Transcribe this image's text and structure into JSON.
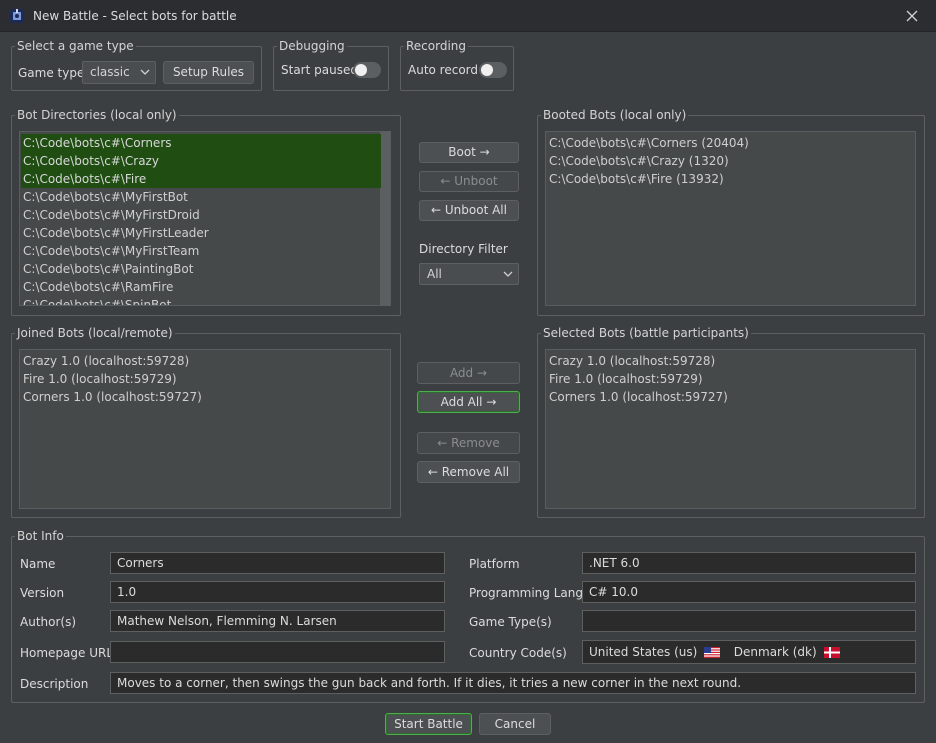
{
  "window": {
    "title": "New Battle - Select bots for battle",
    "app_icon": "robot-tank-icon",
    "close_icon": "close-icon"
  },
  "game_type": {
    "legend": "Select a game type",
    "label": "Game type",
    "selected": "classic",
    "setup_rules_label": "Setup Rules"
  },
  "debugging": {
    "legend": "Debugging",
    "start_paused_label": "Start paused",
    "start_paused_on": false
  },
  "recording": {
    "legend": "Recording",
    "auto_record_label": "Auto record",
    "auto_record_on": false
  },
  "bot_directories": {
    "legend": "Bot Directories (local only)",
    "items": [
      {
        "label": "C:\\Code\\bots\\c#\\Corners",
        "selected": true
      },
      {
        "label": "C:\\Code\\bots\\c#\\Crazy",
        "selected": true
      },
      {
        "label": "C:\\Code\\bots\\c#\\Fire",
        "selected": true
      },
      {
        "label": "C:\\Code\\bots\\c#\\MyFirstBot",
        "selected": false
      },
      {
        "label": "C:\\Code\\bots\\c#\\MyFirstDroid",
        "selected": false
      },
      {
        "label": "C:\\Code\\bots\\c#\\MyFirstLeader",
        "selected": false
      },
      {
        "label": "C:\\Code\\bots\\c#\\MyFirstTeam",
        "selected": false
      },
      {
        "label": "C:\\Code\\bots\\c#\\PaintingBot",
        "selected": false
      },
      {
        "label": "C:\\Code\\bots\\c#\\RamFire",
        "selected": false
      },
      {
        "label": "C:\\Code\\bots\\c#\\SpinBot",
        "selected": false
      }
    ]
  },
  "boot_controls": {
    "boot_label": "Boot →",
    "unboot_label": "← Unboot",
    "unboot_all_label": "← Unboot All",
    "filter_label": "Directory Filter",
    "filter_selected": "All"
  },
  "booted_bots": {
    "legend": "Booted Bots (local only)",
    "items": [
      "C:\\Code\\bots\\c#\\Corners (20404)",
      "C:\\Code\\bots\\c#\\Crazy (1320)",
      "C:\\Code\\bots\\c#\\Fire (13932)"
    ]
  },
  "joined_bots": {
    "legend": "Joined Bots (local/remote)",
    "items": [
      "Crazy 1.0 (localhost:59728)",
      "Fire 1.0 (localhost:59729)",
      "Corners 1.0 (localhost:59727)"
    ]
  },
  "add_controls": {
    "add_label": "Add →",
    "add_all_label": "Add All →",
    "remove_label": "← Remove",
    "remove_all_label": "← Remove All"
  },
  "selected_bots": {
    "legend": "Selected Bots (battle participants)",
    "items": [
      "Crazy 1.0 (localhost:59728)",
      "Fire 1.0 (localhost:59729)",
      "Corners 1.0 (localhost:59727)"
    ]
  },
  "bot_info": {
    "legend": "Bot Info",
    "name_label": "Name",
    "name": "Corners",
    "version_label": "Version",
    "version": "1.0",
    "authors_label": "Author(s)",
    "authors": "Mathew Nelson, Flemming N. Larsen",
    "homepage_label": "Homepage URL",
    "homepage": "",
    "description_label": "Description",
    "description": "Moves to a corner, then swings the gun back and forth. If it dies, it tries a new corner in the next round.",
    "platform_label": "Platform",
    "platform": ".NET 6.0",
    "lang_label": "Programming Lang.",
    "lang": "C# 10.0",
    "game_types_label": "Game Type(s)",
    "game_types": "",
    "country_label": "Country Code(s)",
    "countries": [
      {
        "label": "United States (us)",
        "flag": "us-flag-icon"
      },
      {
        "label": "Denmark (dk)",
        "flag": "dk-flag-icon"
      }
    ]
  },
  "footer": {
    "start_label": "Start Battle",
    "cancel_label": "Cancel"
  },
  "colors": {
    "background": "#3c3f41",
    "selection": "#1f4d12",
    "primary_border": "#4cae4c",
    "field_bg": "#2b2b2b"
  }
}
